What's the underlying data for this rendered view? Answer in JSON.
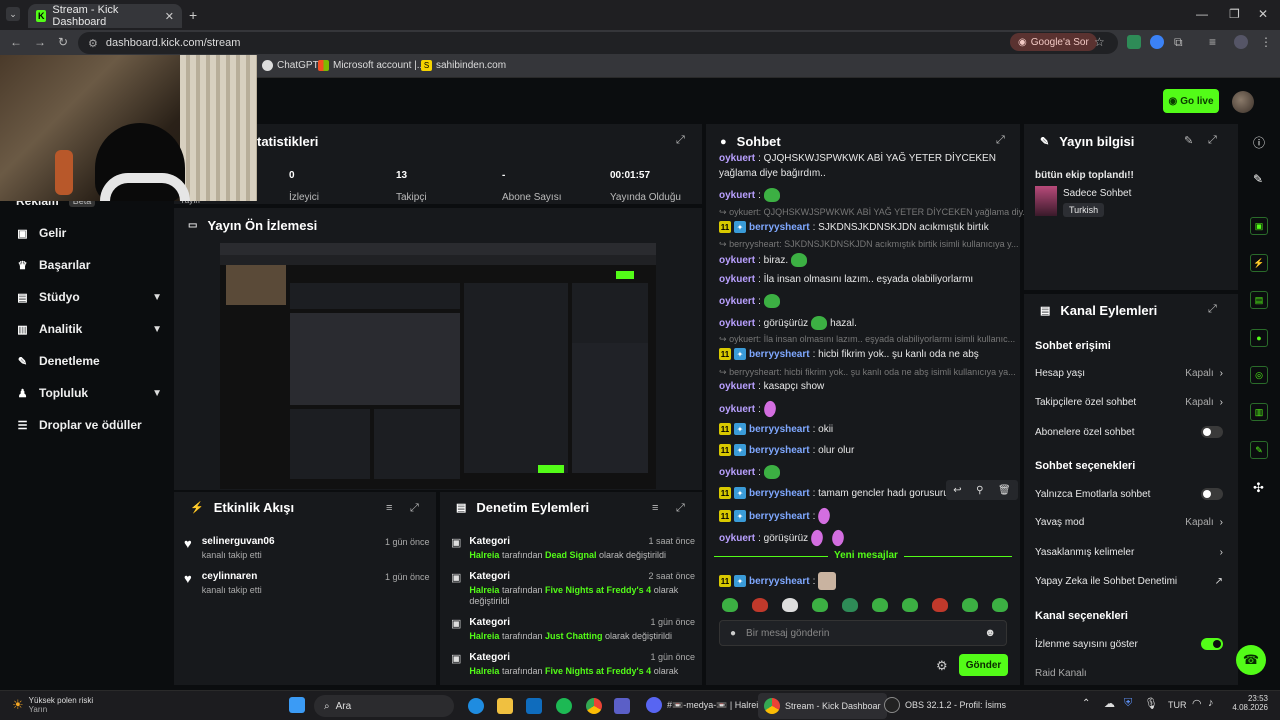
{
  "browser": {
    "tab_title": "Stream - Kick Dashboard",
    "url": "dashboard.kick.com/stream",
    "google_sor": "Google'a Sor",
    "bookmarks": [
      "ChatGPT",
      "Microsoft account |...",
      "sahibinden.com"
    ]
  },
  "header": {
    "go_live": "Go live"
  },
  "sidebar": {
    "items": [
      {
        "label": "Reklam",
        "badge": "Beta"
      },
      {
        "label": "Gelir"
      },
      {
        "label": "Başarılar"
      },
      {
        "label": "Stüdyo"
      },
      {
        "label": "Analitik"
      },
      {
        "label": "Denetleme"
      },
      {
        "label": "Topluluk"
      },
      {
        "label": "Droplar ve ödüller"
      }
    ]
  },
  "stats": {
    "title": "tatistikleri",
    "items": [
      {
        "value": "0",
        "label": "İzleyici"
      },
      {
        "value": "13",
        "label": "Takipçi"
      },
      {
        "value": "-",
        "label": "Abone Sayısı"
      },
      {
        "value": "00:01:57",
        "label": "Yayında Olduğu"
      }
    ],
    "partial_label": "Yayın"
  },
  "preview": {
    "title": "Yayın Ön İzlemesi"
  },
  "activity": {
    "title": "Etkinlik Akışı",
    "items": [
      {
        "name": "selinerguvan06",
        "sub": "kanalı takip etti",
        "time": "1 gün önce"
      },
      {
        "name": "ceylinnaren",
        "sub": "kanalı takip etti",
        "time": "1 gün önce"
      }
    ]
  },
  "moderation": {
    "title": "Denetim Eylemleri",
    "items": [
      {
        "title": "Kategori",
        "actor": "Halreia",
        "mid": "tarafından",
        "target": "Dead Signal",
        "tail": "olarak değiştirildi",
        "time": "1 saat önce"
      },
      {
        "title": "Kategori",
        "actor": "Halreia",
        "mid": "tarafından",
        "target": "Five Nights at Freddy's 4",
        "tail": "olarak değiştirildi",
        "time": "2 saat önce"
      },
      {
        "title": "Kategori",
        "actor": "Halreia",
        "mid": "tarafından",
        "target": "Just Chatting",
        "tail": "olarak değiştirildi",
        "time": "1 gün önce"
      },
      {
        "title": "Kategori",
        "actor": "Halreia",
        "mid": "tarafından",
        "target": "Five Nights at Freddy's 4",
        "tail": "olarak",
        "time": "1 gün önce"
      }
    ]
  },
  "chat": {
    "title": "Sohbet",
    "messages": [
      {
        "user": "oykuert",
        "text": ": QJQHSKWJSPWKWK ABİ YAĞ YETER DİYCEKEN"
      },
      {
        "text": "yağlama diye bağırdım.."
      },
      {
        "user": "oykuert",
        "text": ":"
      },
      {
        "dim": "oykuert: QJQHSKWJSPWKWK ABİ YAĞ YETER DİYCEKEN yağlama diy..."
      },
      {
        "user": "berryysheart",
        "text": ": SJKDNSJKDNSKJDN acıkmıştık birtık"
      },
      {
        "dim": "berryysheart: SJKDNSJKDNSKJDN acıkmıştık birtik isimli kullanıcıya y..."
      },
      {
        "user": "oykuert",
        "text": ": biraz."
      },
      {
        "user": "oykuert",
        "text": ": İla insan olmasını lazım.. eşyada olabiliyorlarmı"
      },
      {
        "user": "oykuert",
        "text": ":"
      },
      {
        "user": "oykuert",
        "text": ": görüşürüz",
        "tail": "hazal."
      },
      {
        "dim": "oykuert: İla insan olmasını lazım.. eşyada olabiliyorlarmı isimli kullanıc..."
      },
      {
        "user": "berryysheart",
        "text": ": hicbi fikrim yok.. şu kanlı oda ne abş"
      },
      {
        "dim": "berryysheart: hicbi fikrim yok.. şu kanlı oda ne abş isimli kullanıcıya ya..."
      },
      {
        "user": "oykuert",
        "text": ": kasapçı show"
      },
      {
        "user": "oykuert",
        "text": ":"
      },
      {
        "user": "berryysheart",
        "text": ": okii"
      },
      {
        "user": "berryysheart",
        "text": ": olur olur"
      },
      {
        "user": "oykuert",
        "text": ":"
      },
      {
        "user": "berryysheart",
        "text": ": tamam gencler hadı gorusuru..."
      },
      {
        "user": "berryysheart",
        "text": ":"
      },
      {
        "user": "oykuert",
        "text": ": görüşürüz"
      },
      {
        "user": "berryysheart",
        "text": ":"
      }
    ],
    "new_messages": "Yeni mesajlar",
    "placeholder": "Bir mesaj gönderin",
    "send": "Gönder"
  },
  "stream_info": {
    "title": "Yayın bilgisi",
    "stream_title": "bütün ekip toplandı!!",
    "category": "Sadece Sohbet",
    "language": "Turkish"
  },
  "channel_actions": {
    "title": "Kanal Eylemleri",
    "sections": {
      "chat_access": "Sohbet erişimi",
      "chat_options": "Sohbet seçenekleri",
      "channel_options": "Kanal seçenekleri"
    },
    "rows": {
      "hesap_yasi": {
        "label": "Hesap yaşı",
        "value": "Kapalı"
      },
      "takipci": {
        "label": "Takipçilere özel sohbet",
        "value": "Kapalı"
      },
      "abone": {
        "label": "Abonelere özel sohbet"
      },
      "emote": {
        "label": "Yalnızca Emotlarla sohbet"
      },
      "yavas": {
        "label": "Yavaş mod",
        "value": "Kapalı"
      },
      "yasak": {
        "label": "Yasaklanmış kelimeler"
      },
      "ai": {
        "label": "Yapay Zeka ile Sohbet Denetimi"
      },
      "izlenme": {
        "label": "İzlenme sayısını göster"
      },
      "raid": {
        "label": "Raid Kanalı"
      }
    }
  },
  "taskbar": {
    "weather_title": "Yüksek polen riski",
    "weather_sub": "Yarın",
    "search": "Ara",
    "apps": [
      "#📼-medya-📼 | Halrei",
      "Stream - Kick Dashboar",
      "OBS 32.1.2 - Profil: İsims"
    ],
    "lang": "TUR",
    "time": "23:53",
    "date": "4.08.2026"
  },
  "colors": {
    "accent": "#53fc18",
    "panel": "#17191c",
    "bg": "#0b0d0f"
  }
}
